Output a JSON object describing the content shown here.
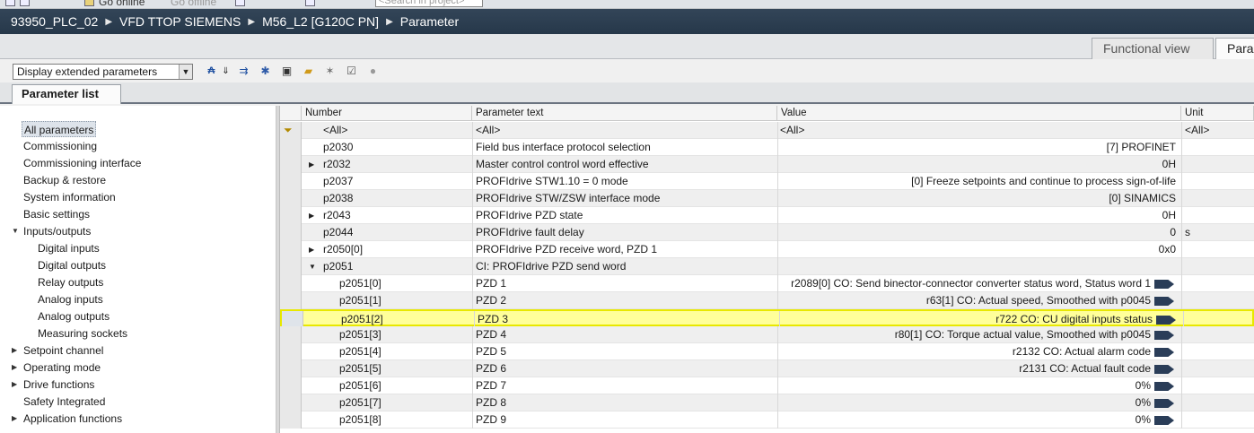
{
  "toolbar_top": {
    "go_online": "Go online",
    "go_offline": "Go offline",
    "search_placeholder": "<Search in project>"
  },
  "breadcrumb": [
    "93950_PLC_02",
    "VFD TTOP SIEMENS",
    "M56_L2 [G120C PN]",
    "Parameter"
  ],
  "view_tabs": {
    "functional": "Functional view",
    "parameter": "Parameter view"
  },
  "display_select": {
    "value": "Display extended parameters"
  },
  "parameter_list_tab": "Parameter list",
  "nav": {
    "items": [
      {
        "label": "All parameters",
        "level": 0,
        "expander": "",
        "selected": true
      },
      {
        "label": "Commissioning",
        "level": 0,
        "expander": ""
      },
      {
        "label": "Commissioning interface",
        "level": 0,
        "expander": ""
      },
      {
        "label": "Backup & restore",
        "level": 0,
        "expander": ""
      },
      {
        "label": "System information",
        "level": 0,
        "expander": ""
      },
      {
        "label": "Basic settings",
        "level": 0,
        "expander": ""
      },
      {
        "label": "Inputs/outputs",
        "level": 0,
        "expander": "▼"
      },
      {
        "label": "Digital inputs",
        "level": 1,
        "expander": ""
      },
      {
        "label": "Digital outputs",
        "level": 1,
        "expander": ""
      },
      {
        "label": "Relay outputs",
        "level": 1,
        "expander": ""
      },
      {
        "label": "Analog inputs",
        "level": 1,
        "expander": ""
      },
      {
        "label": "Analog outputs",
        "level": 1,
        "expander": ""
      },
      {
        "label": "Measuring sockets",
        "level": 1,
        "expander": ""
      },
      {
        "label": "Setpoint channel",
        "level": 0,
        "expander": "▶"
      },
      {
        "label": "Operating mode",
        "level": 0,
        "expander": "▶"
      },
      {
        "label": "Drive functions",
        "level": 0,
        "expander": "▶"
      },
      {
        "label": "Safety Integrated",
        "level": 0,
        "expander": ""
      },
      {
        "label": "Application functions",
        "level": 0,
        "expander": "▶"
      }
    ]
  },
  "table": {
    "columns": {
      "number": "Number",
      "text": "Parameter text",
      "value": "Value",
      "unit": "Unit"
    },
    "filter": {
      "number": "<All>",
      "text": "<All>",
      "value": "<All>",
      "unit": "<All>"
    },
    "rows": [
      {
        "number": "p2030",
        "text": "Field bus interface protocol selection",
        "value": "[7] PROFINET",
        "unit": "",
        "expander": "",
        "sub": false,
        "connector": false
      },
      {
        "number": "r2032",
        "text": "Master control control word effective",
        "value": "0H",
        "unit": "",
        "expander": "▶",
        "sub": false,
        "connector": false
      },
      {
        "number": "p2037",
        "text": "PROFIdrive STW1.10 = 0 mode",
        "value": "[0] Freeze setpoints and continue to process sign-of-life",
        "unit": "",
        "expander": "",
        "sub": false,
        "connector": false
      },
      {
        "number": "p2038",
        "text": "PROFIdrive STW/ZSW interface mode",
        "value": "[0] SINAMICS",
        "unit": "",
        "expander": "",
        "sub": false,
        "connector": false
      },
      {
        "number": "r2043",
        "text": "PROFIdrive PZD state",
        "value": "0H",
        "unit": "",
        "expander": "▶",
        "sub": false,
        "connector": false
      },
      {
        "number": "p2044",
        "text": "PROFIdrive fault delay",
        "value": "0",
        "unit": "s",
        "expander": "",
        "sub": false,
        "connector": false
      },
      {
        "number": "r2050[0]",
        "text": "PROFIdrive PZD receive word, PZD 1",
        "value": "0x0",
        "unit": "",
        "expander": "▶",
        "sub": false,
        "connector": false
      },
      {
        "number": "p2051",
        "text": "CI: PROFIdrive PZD send word",
        "value": "",
        "unit": "",
        "expander": "▼",
        "sub": false,
        "connector": false
      },
      {
        "number": "p2051[0]",
        "text": "PZD 1",
        "value": "r2089[0] CO: Send binector-connector converter status word, Status word 1",
        "unit": "",
        "expander": "",
        "sub": true,
        "connector": true
      },
      {
        "number": "p2051[1]",
        "text": "PZD 2",
        "value": "r63[1] CO: Actual speed, Smoothed with p0045",
        "unit": "",
        "expander": "",
        "sub": true,
        "connector": true
      },
      {
        "number": "p2051[2]",
        "text": "PZD 3",
        "value": "r722 CO: CU digital inputs status",
        "unit": "",
        "expander": "",
        "sub": true,
        "connector": true,
        "highlight": true
      },
      {
        "number": "p2051[3]",
        "text": "PZD 4",
        "value": "r80[1] CO: Torque actual value, Smoothed with p0045",
        "unit": "",
        "expander": "",
        "sub": true,
        "connector": true
      },
      {
        "number": "p2051[4]",
        "text": "PZD 5",
        "value": "r2132 CO: Actual alarm code",
        "unit": "",
        "expander": "",
        "sub": true,
        "connector": true
      },
      {
        "number": "p2051[5]",
        "text": "PZD 6",
        "value": "r2131 CO: Actual fault code",
        "unit": "",
        "expander": "",
        "sub": true,
        "connector": true
      },
      {
        "number": "p2051[6]",
        "text": "PZD 7",
        "value": "0%",
        "unit": "",
        "expander": "",
        "sub": true,
        "connector": true
      },
      {
        "number": "p2051[7]",
        "text": "PZD 8",
        "value": "0%",
        "unit": "",
        "expander": "",
        "sub": true,
        "connector": true
      },
      {
        "number": "p2051[8]",
        "text": "PZD 9",
        "value": "0%",
        "unit": "",
        "expander": "",
        "sub": true,
        "connector": true
      }
    ]
  }
}
